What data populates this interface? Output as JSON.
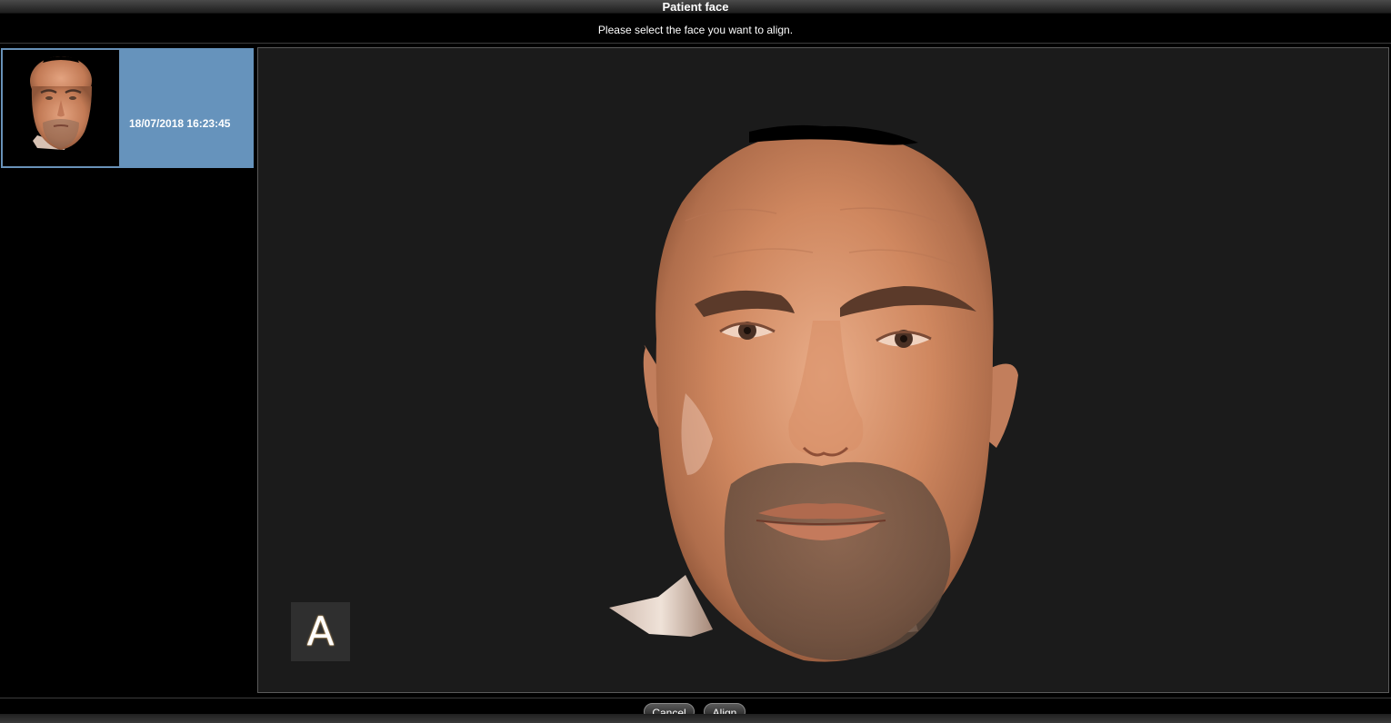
{
  "window": {
    "title": "Patient face"
  },
  "instruction": "Please select the face you want to align.",
  "face_list": {
    "items": [
      {
        "date": "18/07/2018 16:23:45",
        "selected": true
      }
    ]
  },
  "viewer": {
    "view_label": "A"
  },
  "buttons": {
    "cancel": "Cancel",
    "align": "Align"
  },
  "colors": {
    "selection": "#6693bc",
    "viewer_bg": "#1b1b1b",
    "skin": "#c77d5a"
  }
}
